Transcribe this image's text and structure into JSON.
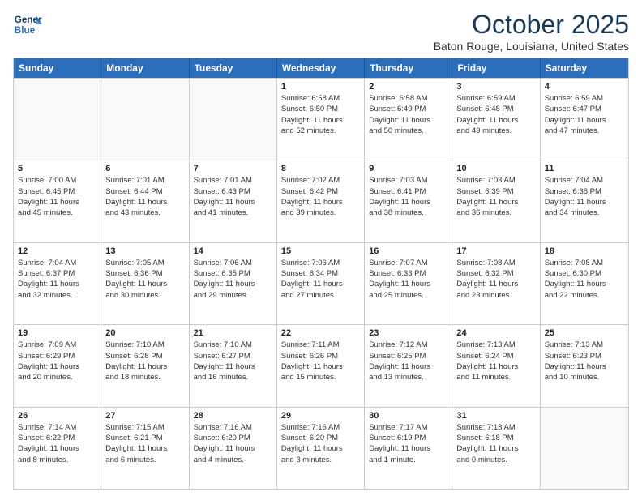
{
  "header": {
    "logo_line1": "General",
    "logo_line2": "Blue",
    "month": "October 2025",
    "location": "Baton Rouge, Louisiana, United States"
  },
  "days_of_week": [
    "Sunday",
    "Monday",
    "Tuesday",
    "Wednesday",
    "Thursday",
    "Friday",
    "Saturday"
  ],
  "rows": [
    [
      {
        "day": "",
        "info": "",
        "empty": true
      },
      {
        "day": "",
        "info": "",
        "empty": true
      },
      {
        "day": "",
        "info": "",
        "empty": true
      },
      {
        "day": "1",
        "info": "Sunrise: 6:58 AM\nSunset: 6:50 PM\nDaylight: 11 hours\nand 52 minutes.",
        "empty": false
      },
      {
        "day": "2",
        "info": "Sunrise: 6:58 AM\nSunset: 6:49 PM\nDaylight: 11 hours\nand 50 minutes.",
        "empty": false
      },
      {
        "day": "3",
        "info": "Sunrise: 6:59 AM\nSunset: 6:48 PM\nDaylight: 11 hours\nand 49 minutes.",
        "empty": false
      },
      {
        "day": "4",
        "info": "Sunrise: 6:59 AM\nSunset: 6:47 PM\nDaylight: 11 hours\nand 47 minutes.",
        "empty": false
      }
    ],
    [
      {
        "day": "5",
        "info": "Sunrise: 7:00 AM\nSunset: 6:45 PM\nDaylight: 11 hours\nand 45 minutes.",
        "empty": false
      },
      {
        "day": "6",
        "info": "Sunrise: 7:01 AM\nSunset: 6:44 PM\nDaylight: 11 hours\nand 43 minutes.",
        "empty": false
      },
      {
        "day": "7",
        "info": "Sunrise: 7:01 AM\nSunset: 6:43 PM\nDaylight: 11 hours\nand 41 minutes.",
        "empty": false
      },
      {
        "day": "8",
        "info": "Sunrise: 7:02 AM\nSunset: 6:42 PM\nDaylight: 11 hours\nand 39 minutes.",
        "empty": false
      },
      {
        "day": "9",
        "info": "Sunrise: 7:03 AM\nSunset: 6:41 PM\nDaylight: 11 hours\nand 38 minutes.",
        "empty": false
      },
      {
        "day": "10",
        "info": "Sunrise: 7:03 AM\nSunset: 6:39 PM\nDaylight: 11 hours\nand 36 minutes.",
        "empty": false
      },
      {
        "day": "11",
        "info": "Sunrise: 7:04 AM\nSunset: 6:38 PM\nDaylight: 11 hours\nand 34 minutes.",
        "empty": false
      }
    ],
    [
      {
        "day": "12",
        "info": "Sunrise: 7:04 AM\nSunset: 6:37 PM\nDaylight: 11 hours\nand 32 minutes.",
        "empty": false
      },
      {
        "day": "13",
        "info": "Sunrise: 7:05 AM\nSunset: 6:36 PM\nDaylight: 11 hours\nand 30 minutes.",
        "empty": false
      },
      {
        "day": "14",
        "info": "Sunrise: 7:06 AM\nSunset: 6:35 PM\nDaylight: 11 hours\nand 29 minutes.",
        "empty": false
      },
      {
        "day": "15",
        "info": "Sunrise: 7:06 AM\nSunset: 6:34 PM\nDaylight: 11 hours\nand 27 minutes.",
        "empty": false
      },
      {
        "day": "16",
        "info": "Sunrise: 7:07 AM\nSunset: 6:33 PM\nDaylight: 11 hours\nand 25 minutes.",
        "empty": false
      },
      {
        "day": "17",
        "info": "Sunrise: 7:08 AM\nSunset: 6:32 PM\nDaylight: 11 hours\nand 23 minutes.",
        "empty": false
      },
      {
        "day": "18",
        "info": "Sunrise: 7:08 AM\nSunset: 6:30 PM\nDaylight: 11 hours\nand 22 minutes.",
        "empty": false
      }
    ],
    [
      {
        "day": "19",
        "info": "Sunrise: 7:09 AM\nSunset: 6:29 PM\nDaylight: 11 hours\nand 20 minutes.",
        "empty": false
      },
      {
        "day": "20",
        "info": "Sunrise: 7:10 AM\nSunset: 6:28 PM\nDaylight: 11 hours\nand 18 minutes.",
        "empty": false
      },
      {
        "day": "21",
        "info": "Sunrise: 7:10 AM\nSunset: 6:27 PM\nDaylight: 11 hours\nand 16 minutes.",
        "empty": false
      },
      {
        "day": "22",
        "info": "Sunrise: 7:11 AM\nSunset: 6:26 PM\nDaylight: 11 hours\nand 15 minutes.",
        "empty": false
      },
      {
        "day": "23",
        "info": "Sunrise: 7:12 AM\nSunset: 6:25 PM\nDaylight: 11 hours\nand 13 minutes.",
        "empty": false
      },
      {
        "day": "24",
        "info": "Sunrise: 7:13 AM\nSunset: 6:24 PM\nDaylight: 11 hours\nand 11 minutes.",
        "empty": false
      },
      {
        "day": "25",
        "info": "Sunrise: 7:13 AM\nSunset: 6:23 PM\nDaylight: 11 hours\nand 10 minutes.",
        "empty": false
      }
    ],
    [
      {
        "day": "26",
        "info": "Sunrise: 7:14 AM\nSunset: 6:22 PM\nDaylight: 11 hours\nand 8 minutes.",
        "empty": false
      },
      {
        "day": "27",
        "info": "Sunrise: 7:15 AM\nSunset: 6:21 PM\nDaylight: 11 hours\nand 6 minutes.",
        "empty": false
      },
      {
        "day": "28",
        "info": "Sunrise: 7:16 AM\nSunset: 6:20 PM\nDaylight: 11 hours\nand 4 minutes.",
        "empty": false
      },
      {
        "day": "29",
        "info": "Sunrise: 7:16 AM\nSunset: 6:20 PM\nDaylight: 11 hours\nand 3 minutes.",
        "empty": false
      },
      {
        "day": "30",
        "info": "Sunrise: 7:17 AM\nSunset: 6:19 PM\nDaylight: 11 hours\nand 1 minute.",
        "empty": false
      },
      {
        "day": "31",
        "info": "Sunrise: 7:18 AM\nSunset: 6:18 PM\nDaylight: 11 hours\nand 0 minutes.",
        "empty": false
      },
      {
        "day": "",
        "info": "",
        "empty": true
      }
    ]
  ]
}
